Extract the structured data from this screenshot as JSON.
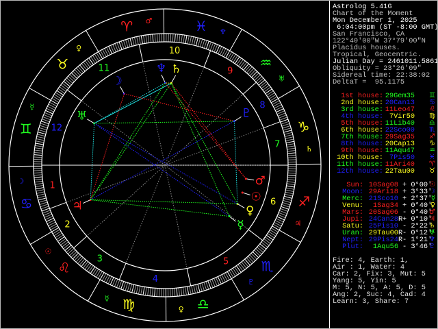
{
  "panel": {
    "header": [
      {
        "text": "Astrolog 5.41G",
        "color": "#ffffff"
      },
      {
        "text": "Chart of the Moment",
        "color": "#c0c0c0"
      },
      {
        "text": "Mon December 1, 2025",
        "color": "#ffffff"
      },
      {
        "text": " 6:04:00pm (ST -8:00 GMT)",
        "color": "#ffffff"
      },
      {
        "text": "San Francisco, CA",
        "color": "#c0c0c0"
      },
      {
        "text": "122°40'00\"W 37°79'00\"N",
        "color": "#c0c0c0"
      },
      {
        "text": "Placidus houses.",
        "color": "#c0c0c0"
      },
      {
        "text": "Tropical, Geocentric.",
        "color": "#c0c0c0"
      },
      {
        "text": "Julian Day = 2461011.5861",
        "color": "#ffffff"
      },
      {
        "text": "Obliquity = 23°26'09\"",
        "color": "#c0c0c0"
      },
      {
        "text": "Sidereal time: 22:38:02",
        "color": "#c0c0c0"
      },
      {
        "text": "DeltaT =  95.1175",
        "color": "#c0c0c0"
      }
    ],
    "houses": [
      {
        "label": "1st house:",
        "pos": "29Gem35",
        "glyph": "♊",
        "label_color": "#ff2020",
        "pos_color": "#20ff20"
      },
      {
        "label": "2nd house:",
        "pos": "20Can13",
        "glyph": "♋",
        "label_color": "#ffff20",
        "pos_color": "#2020ff"
      },
      {
        "label": "3rd house:",
        "pos": "11Leo47",
        "glyph": "♌",
        "label_color": "#20ff20",
        "pos_color": "#ff2020"
      },
      {
        "label": "4th house:",
        "pos": "7Vir50",
        "glyph": "♍",
        "label_color": "#2020ff",
        "pos_color": "#ffff20"
      },
      {
        "label": "5th house:",
        "pos": "11Lib40",
        "glyph": "♎",
        "label_color": "#ff2020",
        "pos_color": "#20ff20"
      },
      {
        "label": "6th house:",
        "pos": "22Sco00",
        "glyph": "♏",
        "label_color": "#ffff20",
        "pos_color": "#2020ff"
      },
      {
        "label": "7th house:",
        "pos": "29Sag35",
        "glyph": "♐",
        "label_color": "#20ff20",
        "pos_color": "#ff2020"
      },
      {
        "label": "8th house:",
        "pos": "20Cap13",
        "glyph": "♑",
        "label_color": "#2020ff",
        "pos_color": "#ffff20"
      },
      {
        "label": "9th house:",
        "pos": "11Aqu47",
        "glyph": "♒",
        "label_color": "#ff2020",
        "pos_color": "#20ff20"
      },
      {
        "label": "10th house:",
        "pos": "7Pis50",
        "glyph": "♓",
        "label_color": "#ffff20",
        "pos_color": "#2020ff"
      },
      {
        "label": "11th house:",
        "pos": "11Ari40",
        "glyph": "♈",
        "label_color": "#20ff20",
        "pos_color": "#ff2020"
      },
      {
        "label": "12th house:",
        "pos": "22Tau00",
        "glyph": "♉",
        "label_color": "#2020ff",
        "pos_color": "#ffff20"
      }
    ],
    "planets": [
      {
        "name": "Sun:",
        "pos": "10Sag08",
        "retro": "",
        "lat": "+ 0°00'",
        "glyph": "☉",
        "name_color": "#ff2020",
        "pos_color": "#ff2020",
        "glyph_color": "#ff2020"
      },
      {
        "name": "Moon:",
        "pos": "29Ari18",
        "retro": "",
        "lat": "+ 3°33'",
        "glyph": "☽",
        "name_color": "#2020ff",
        "pos_color": "#ff2020",
        "glyph_color": "#2020ff"
      },
      {
        "name": "Merc:",
        "pos": "21Sco10",
        "retro": "",
        "lat": "+ 2°37'",
        "glyph": "☿",
        "name_color": "#20ff20",
        "pos_color": "#2020ff",
        "glyph_color": "#20ff20"
      },
      {
        "name": "Venu:",
        "pos": "1Sag34",
        "retro": "",
        "lat": "+ 0°40'",
        "glyph": "♀",
        "name_color": "#ffff20",
        "pos_color": "#ff2020",
        "glyph_color": "#ffff20"
      },
      {
        "name": "Mars:",
        "pos": "20Sag06",
        "retro": "",
        "lat": "- 0°40'",
        "glyph": "♂",
        "name_color": "#ff2020",
        "pos_color": "#ff2020",
        "glyph_color": "#ff2020"
      },
      {
        "name": "Jupi:",
        "pos": "24Can28",
        "retro": "R",
        "lat": "+ 0°10'",
        "glyph": "♃",
        "name_color": "#ff2020",
        "pos_color": "#2020ff",
        "glyph_color": "#ff2020"
      },
      {
        "name": "Satu:",
        "pos": "25Pis10",
        "retro": "",
        "lat": "- 2°22'",
        "glyph": "♄",
        "name_color": "#ffff20",
        "pos_color": "#2020ff",
        "glyph_color": "#ffff20"
      },
      {
        "name": "Uran:",
        "pos": "29Tau00",
        "retro": "R",
        "lat": "- 0°12'",
        "glyph": "♅",
        "name_color": "#20ff20",
        "pos_color": "#ffff20",
        "glyph_color": "#20ff20"
      },
      {
        "name": "Nept:",
        "pos": "29Pis24",
        "retro": "R",
        "lat": "- 1°21'",
        "glyph": "♆",
        "name_color": "#2020ff",
        "pos_color": "#2020ff",
        "glyph_color": "#2020ff"
      },
      {
        "name": "Plut:",
        "pos": "1Aqu56",
        "retro": "",
        "lat": "- 3°46'",
        "glyph": "♇",
        "name_color": "#2020ff",
        "pos_color": "#20ff20",
        "glyph_color": "#2020ff"
      }
    ],
    "summary": [
      "Fire: 4, Earth: 1,",
      "Air : 1, Water: 4",
      "Car: 2, Fix: 3, Mut: 5",
      "Yang: 5, Yin: 5",
      "M: 5, N: 5, A: 5, D: 5",
      "Ang: 2, Suc: 4, Cad: 4",
      "Learn: 3, Share: 7"
    ]
  },
  "chart": {
    "ascendant": 89.58,
    "signs": [
      {
        "name": "aries",
        "glyph": "♈",
        "color": "#ff2020",
        "ruler": "♂",
        "ruler_color": "#ff2020"
      },
      {
        "name": "taurus",
        "glyph": "♉",
        "color": "#ffff20",
        "ruler": "♀",
        "ruler_color": "#ffff20"
      },
      {
        "name": "gemini",
        "glyph": "♊",
        "color": "#20ff20",
        "ruler": "☿",
        "ruler_color": "#20ff20"
      },
      {
        "name": "cancer",
        "glyph": "♋",
        "color": "#2020ff",
        "ruler": "☽",
        "ruler_color": "#2020ff"
      },
      {
        "name": "leo",
        "glyph": "♌",
        "color": "#ff2020",
        "ruler": "☉",
        "ruler_color": "#ff2020"
      },
      {
        "name": "virgo",
        "glyph": "♍",
        "color": "#ffff20",
        "ruler": "☿",
        "ruler_color": "#20ff20"
      },
      {
        "name": "libra",
        "glyph": "♎",
        "color": "#20ff20",
        "ruler": "♀",
        "ruler_color": "#ffff20"
      },
      {
        "name": "scorpio",
        "glyph": "♏",
        "color": "#2020ff",
        "ruler": "♇",
        "ruler_color": "#2020ff"
      },
      {
        "name": "sagittarius",
        "glyph": "♐",
        "color": "#ff2020",
        "ruler": "♃",
        "ruler_color": "#ff2020"
      },
      {
        "name": "capricorn",
        "glyph": "♑",
        "color": "#ffff20",
        "ruler": "♄",
        "ruler_color": "#ffff20"
      },
      {
        "name": "aquarius",
        "glyph": "♒",
        "color": "#20ff20",
        "ruler": "♅",
        "ruler_color": "#20ff20"
      },
      {
        "name": "pisces",
        "glyph": "♓",
        "color": "#2020ff",
        "ruler": "♆",
        "ruler_color": "#2020ff"
      }
    ],
    "house_cusps": [
      {
        "number": "1",
        "longitude": 89.58,
        "color": "#ff2020"
      },
      {
        "number": "2",
        "longitude": 110.22,
        "color": "#ffff20"
      },
      {
        "number": "3",
        "longitude": 131.78,
        "color": "#20ff20"
      },
      {
        "number": "4",
        "longitude": 157.83,
        "color": "#2020ff"
      },
      {
        "number": "5",
        "longitude": 191.67,
        "color": "#ff2020"
      },
      {
        "number": "6",
        "longitude": 232.0,
        "color": "#ffff20"
      },
      {
        "number": "7",
        "longitude": 269.58,
        "color": "#20ff20"
      },
      {
        "number": "8",
        "longitude": 290.22,
        "color": "#2020ff"
      },
      {
        "number": "9",
        "longitude": 311.78,
        "color": "#ff2020"
      },
      {
        "number": "10",
        "longitude": 337.83,
        "color": "#ffff20"
      },
      {
        "number": "11",
        "longitude": 11.67,
        "color": "#20ff20"
      },
      {
        "number": "12",
        "longitude": 52.0,
        "color": "#2020ff"
      }
    ],
    "planets": [
      {
        "name": "sun",
        "glyph": "☉",
        "longitude": 250.13,
        "color": "#ff2020"
      },
      {
        "name": "moon",
        "glyph": "☽",
        "longitude": 29.3,
        "color": "#2020ff"
      },
      {
        "name": "mercury",
        "glyph": "☿",
        "longitude": 231.17,
        "color": "#20ff20"
      },
      {
        "name": "venus",
        "glyph": "♀",
        "longitude": 241.57,
        "color": "#ffff20"
      },
      {
        "name": "mars",
        "glyph": "♂",
        "longitude": 260.1,
        "color": "#ff2020"
      },
      {
        "name": "jupiter",
        "glyph": "♃",
        "longitude": 114.47,
        "color": "#ff2020"
      },
      {
        "name": "saturn",
        "glyph": "♄",
        "longitude": 355.17,
        "color": "#ffff20"
      },
      {
        "name": "uranus",
        "glyph": "♅",
        "longitude": 59.0,
        "color": "#20ff20"
      },
      {
        "name": "neptune",
        "glyph": "♆",
        "longitude": 359.4,
        "color": "#2020ff"
      },
      {
        "name": "pluto",
        "glyph": "♇",
        "longitude": 301.93,
        "color": "#2020ff"
      }
    ],
    "aspect_colors": {
      "conjunction": "#ffff20",
      "opposition": "#2020ff",
      "square": "#ff2020",
      "trine": "#20ff20",
      "sextile": "#20e0e0"
    },
    "aspects": [
      {
        "a": "saturn",
        "b": "uranus",
        "type": "sextile"
      },
      {
        "a": "uranus",
        "b": "neptune",
        "type": "sextile"
      },
      {
        "a": "uranus",
        "b": "venus",
        "type": "opposition"
      },
      {
        "a": "uranus",
        "b": "mercury",
        "type": "opposition"
      },
      {
        "a": "jupiter",
        "b": "pluto",
        "type": "opposition"
      },
      {
        "a": "moon",
        "b": "jupiter",
        "type": "square"
      },
      {
        "a": "moon",
        "b": "pluto",
        "type": "square"
      },
      {
        "a": "mars",
        "b": "saturn",
        "type": "square"
      },
      {
        "a": "mars",
        "b": "neptune",
        "type": "square"
      },
      {
        "a": "jupiter",
        "b": "saturn",
        "type": "trine"
      },
      {
        "a": "jupiter",
        "b": "neptune",
        "type": "trine"
      },
      {
        "a": "mercury",
        "b": "jupiter",
        "type": "trine"
      },
      {
        "a": "mercury",
        "b": "saturn",
        "type": "trine"
      },
      {
        "a": "venus",
        "b": "saturn",
        "type": "trine"
      },
      {
        "a": "venus",
        "b": "jupiter",
        "type": "trine"
      },
      {
        "a": "uranus",
        "b": "pluto",
        "type": "trine"
      },
      {
        "a": "jupiter",
        "b": "uranus",
        "type": "sextile"
      },
      {
        "a": "venus",
        "b": "pluto",
        "type": "sextile"
      },
      {
        "a": "saturn",
        "b": "neptune",
        "type": "conjunction"
      }
    ]
  }
}
